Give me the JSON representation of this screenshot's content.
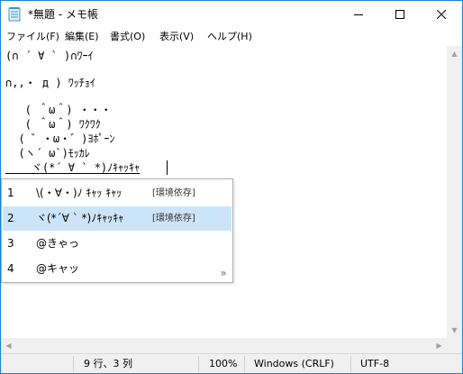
{
  "window": {
    "title": "*無題 - メモ帳",
    "accent": "#1883d7",
    "controls": {
      "minimize": "—",
      "maximize": "☐",
      "close": "✕"
    }
  },
  "menu": {
    "items": [
      {
        "label": "ファイル(F)"
      },
      {
        "label": "編集(E)"
      },
      {
        "label": "書式(O)"
      },
      {
        "label": "表示(V)"
      },
      {
        "label": "ヘルプ(H)"
      }
    ]
  },
  "editor": {
    "lines": [
      "(∩ ´ ∀ ` )∩ﾜｰｲ",
      "∩,,・ д ) ﾜｯﾁｮｲ",
      "   ( ＾ω＾) ・・・",
      "   ( ＾ω＾) ﾜｸﾜｸ",
      "  ( ゛・ω・゛)ﾖﾎﾟｰﾝ",
      "  (ヽ´ ω`)ﾓｯｶﾚ",
      "    ヾ(*´ ∀ ` *)ﾉｷｬｯｷｬ"
    ]
  },
  "candidates": {
    "items": [
      {
        "num": "1",
        "text": "\\(・∀・)ﾉ ｷｬｯ ｷｬｯ",
        "note": "[環境依存]"
      },
      {
        "num": "2",
        "text": "ヾ(*´∀ ` *)ﾉｷｬｯｷｬ",
        "note": "[環境依存]"
      },
      {
        "num": "3",
        "text": "@きゃっ",
        "note": ""
      },
      {
        "num": "4",
        "text": "@キャッ",
        "note": ""
      }
    ],
    "selected_index": 1,
    "selected_color": "#cce4f7",
    "expand_label": "»"
  },
  "status": {
    "position": "9 行、3 列",
    "zoom": "100%",
    "line_ending": "Windows (CRLF)",
    "encoding": "UTF-8"
  }
}
